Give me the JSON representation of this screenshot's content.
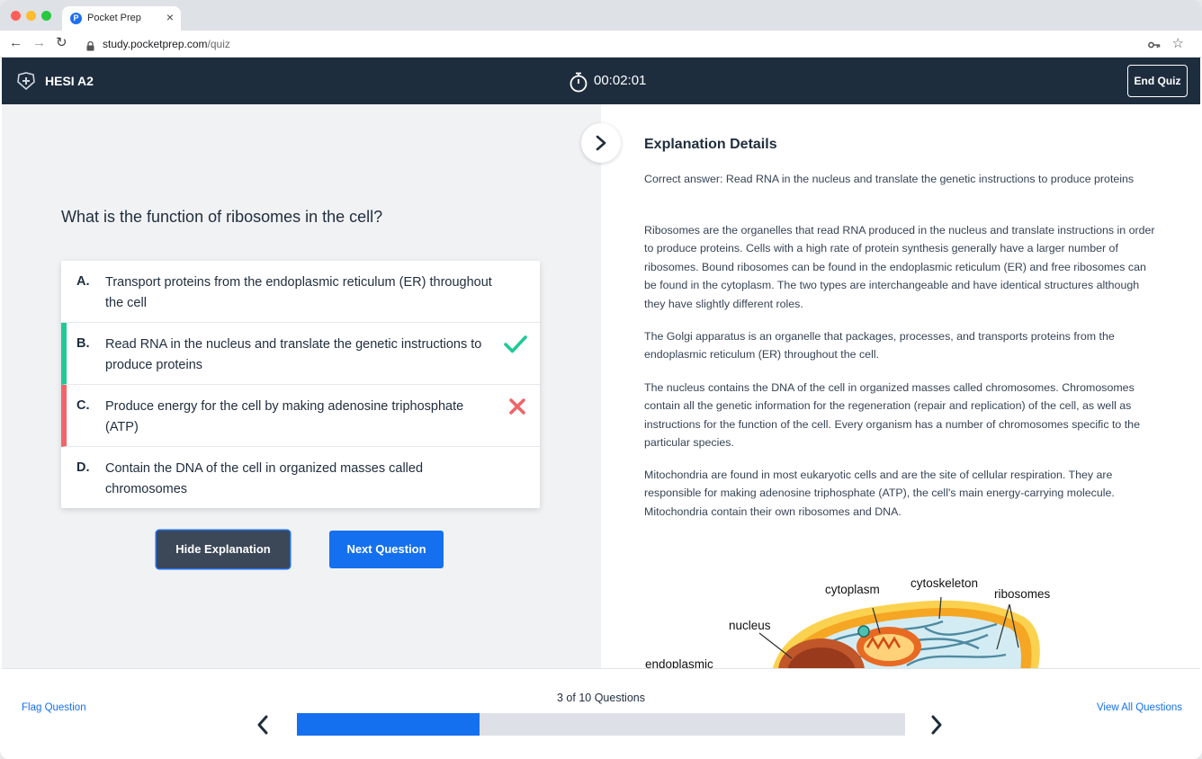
{
  "browser": {
    "tab_title": "Pocket Prep",
    "url_host": "study.pocketprep.com",
    "url_path": "/quiz"
  },
  "app": {
    "exam_title": "HESI A2",
    "timer": "00:02:01",
    "end_quiz_label": "End Quiz"
  },
  "question": {
    "text": "What is the function of ribosomes in the cell?",
    "answers": [
      {
        "letter": "A.",
        "text": "Transport proteins from the endoplasmic reticulum (ER) throughout the cell",
        "state": "none"
      },
      {
        "letter": "B.",
        "text": "Read RNA in the nucleus and translate the genetic instructions to produce proteins",
        "state": "correct"
      },
      {
        "letter": "C.",
        "text": "Produce energy for the cell by making adenosine triphosphate (ATP)",
        "state": "wrong"
      },
      {
        "letter": "D.",
        "text": "Contain the DNA of the cell in organized masses called chromosomes",
        "state": "none"
      }
    ],
    "hide_explanation_label": "Hide Explanation",
    "next_question_label": "Next Question"
  },
  "explanation": {
    "title": "Explanation Details",
    "paragraphs": [
      "Correct answer: Read RNA in the nucleus and translate the genetic instructions to produce proteins",
      "Ribosomes are the organelles that read RNA produced in the nucleus and translate instructions in order to produce proteins. Cells with a high rate of protein synthesis generally have a larger number of ribosomes. Bound ribosomes can be found in the endoplasmic reticulum (ER) and free ribosomes can be found in the cytoplasm. The two types are interchangeable and have identical structures although they have slightly different roles.",
      "The Golgi apparatus is an organelle that packages, processes, and transports proteins from the endoplasmic reticulum (ER) throughout the cell.",
      "The nucleus contains the DNA of the cell in organized masses called chromosomes. Chromosomes contain all the genetic information for the regeneration (repair and replication) of the cell, as well as instructions for the function of the cell. Every organism has a number of chromosomes specific to the particular species.",
      "Mitochondria are found in most eukaryotic cells and are the site of cellular respiration. They are responsible for making adenosine triphosphate (ATP), the cell's main energy-carrying molecule. Mitochondria contain their own ribosomes and DNA."
    ],
    "figure_labels": {
      "cytoplasm": "cytoplasm",
      "cytoskeleton": "cytoskeleton",
      "ribosomes": "ribosomes",
      "nucleus": "nucleus",
      "er": "endoplasmic"
    }
  },
  "footer": {
    "flag_label": "Flag Question",
    "view_all_label": "View All Questions",
    "progress_label": "3 of 10 Questions",
    "progress_fraction": 0.3
  },
  "colors": {
    "header_bg": "#1e2d3e",
    "accent": "#1570ef",
    "correct": "#20c997",
    "wrong": "#f0646a"
  }
}
